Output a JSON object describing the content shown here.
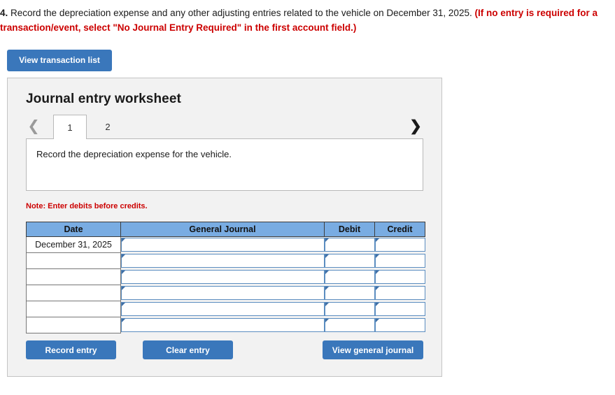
{
  "prompt": {
    "number": "4.",
    "black_text": "Record the depreciation expense and any other adjusting entries related to the vehicle on December 31, 2025.",
    "red_text": "(If no entry is required for a transaction/event, select \"No Journal Entry Required\" in the first account field.)"
  },
  "toolbar": {
    "view_transaction_list_label": "View transaction list"
  },
  "panel": {
    "title": "Journal entry worksheet",
    "prev_icon": "chevron-left-icon",
    "next_icon": "chevron-right-icon",
    "tabs": [
      {
        "label": "1",
        "active": true
      },
      {
        "label": "2",
        "active": false
      }
    ],
    "instruction": "Record the depreciation expense for the vehicle.",
    "note": "Note: Enter debits before credits."
  },
  "table": {
    "headers": [
      "Date",
      "General Journal",
      "Debit",
      "Credit"
    ],
    "rows": [
      {
        "date": "December 31, 2025",
        "account": "",
        "debit": "",
        "credit": ""
      },
      {
        "date": "",
        "account": "",
        "debit": "",
        "credit": ""
      },
      {
        "date": "",
        "account": "",
        "debit": "",
        "credit": ""
      },
      {
        "date": "",
        "account": "",
        "debit": "",
        "credit": ""
      },
      {
        "date": "",
        "account": "",
        "debit": "",
        "credit": ""
      },
      {
        "date": "",
        "account": "",
        "debit": "",
        "credit": ""
      }
    ]
  },
  "actions": {
    "record_entry_label": "Record entry",
    "clear_entry_label": "Clear entry",
    "view_general_journal_label": "View general journal"
  },
  "colors": {
    "button_blue": "#3a77bb",
    "header_blue": "#79ace2",
    "note_red": "#cc0000",
    "panel_gray": "#f2f2f2",
    "field_border_blue": "#5b8dc0"
  }
}
